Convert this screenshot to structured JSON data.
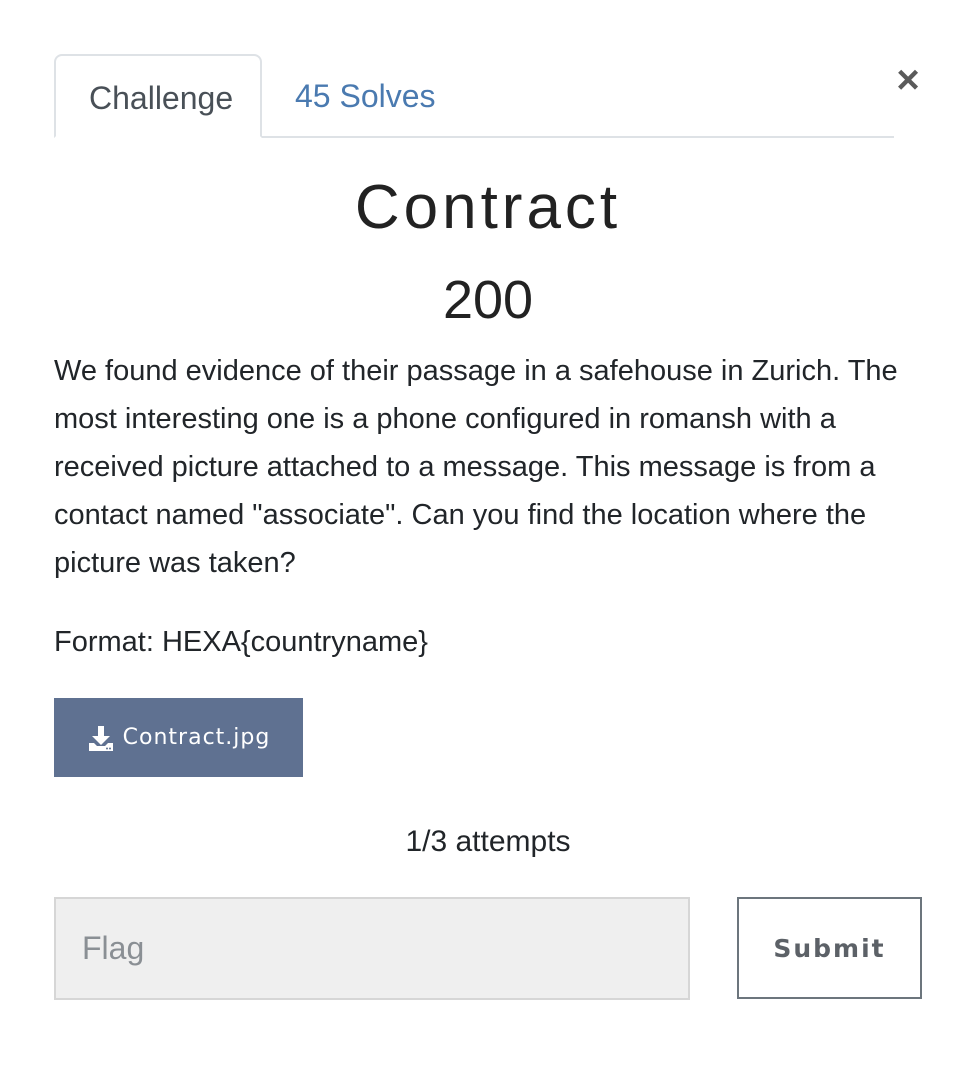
{
  "tabs": [
    {
      "label": "Challenge"
    },
    {
      "label": "45 Solves"
    }
  ],
  "close_glyph": "×",
  "challenge": {
    "name": "Contract",
    "value": "200",
    "description": "We found evidence of their passage in a safehouse in Zurich. The most interesting one is a phone configured in romansh with a received picture attached to a message. This message is from a contact named \"associate\". Can you find the location where the picture was taken?",
    "format": "Format: HEXA{countryname}"
  },
  "file": {
    "icon": "download-icon",
    "label": "Contract.jpg"
  },
  "attempts": "1/3 attempts",
  "form": {
    "flag_placeholder": "Flag",
    "flag_value": "",
    "submit_label": "Submit"
  },
  "colors": {
    "download_button": "#5f7191",
    "tab_link": "#4a7ab0",
    "input_bg": "#efefef"
  }
}
